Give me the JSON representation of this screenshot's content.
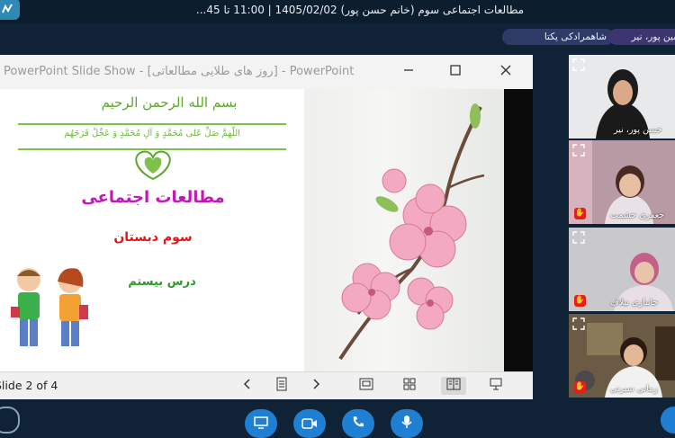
{
  "meeting": {
    "title": "مطالعات اجتماعی سوم (خانم حسن پور) 1405/02/02 | 11:00 تا 45..."
  },
  "participant_chips": [
    "شاهمرادکی یکتا",
    "حسین پور، نیر"
  ],
  "powerpoint": {
    "window_title": "PowerPoint Slide Show - [روز های طلایی مطالعاتی] - PowerPoint",
    "slide": {
      "basmala": "بسم الله الرحمن الرحیم",
      "salawat": "اللّهمَّ صَلِّ عَلی مُحَمَّدٍ وَ آلِ مُحَمَّدٍ وَ عَجِّلْ فَرَجَهُم",
      "subject": "مطالعات اجتماعی",
      "grade": "سوم دبستان",
      "lesson": "درس بیستم"
    },
    "status": {
      "slide_counter": "Slide 2 of 4"
    }
  },
  "participants": [
    {
      "name": "حسن پور، نیر"
    },
    {
      "name": "جعفری حشمت"
    },
    {
      "name": "جانبازی نیلاف"
    },
    {
      "name": "زمانی سیرتی"
    }
  ],
  "colors": {
    "accent": "#1f7fd2",
    "background": "#0f2236",
    "subject": "#c316b8",
    "grade": "#e61414",
    "lesson": "#2a9a2a",
    "basmala": "#5aa82d"
  },
  "icons": {
    "controls": [
      "share-screen-icon",
      "camera-icon",
      "phone-icon",
      "microphone-icon"
    ]
  }
}
